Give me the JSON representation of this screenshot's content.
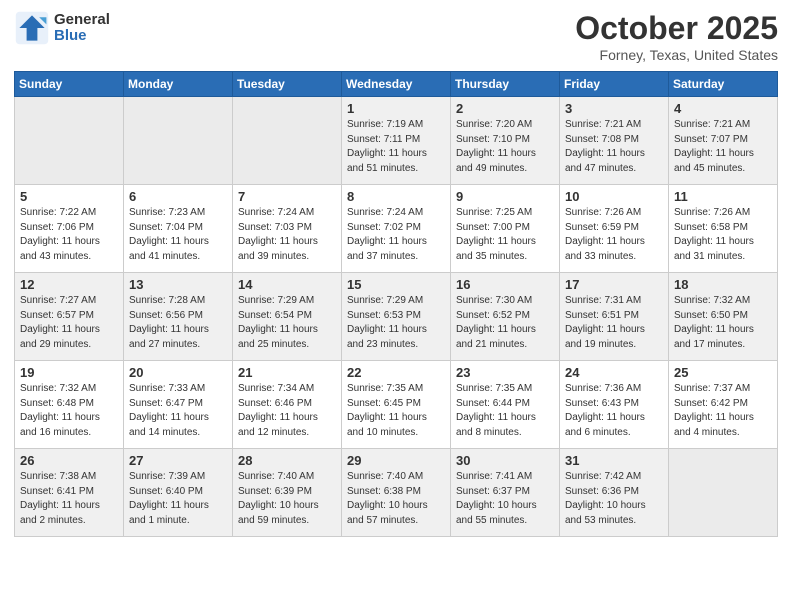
{
  "header": {
    "logo_general": "General",
    "logo_blue": "Blue",
    "title": "October 2025",
    "location": "Forney, Texas, United States"
  },
  "days_of_week": [
    "Sunday",
    "Monday",
    "Tuesday",
    "Wednesday",
    "Thursday",
    "Friday",
    "Saturday"
  ],
  "weeks": [
    [
      {
        "day": "",
        "empty": true
      },
      {
        "day": "",
        "empty": true
      },
      {
        "day": "",
        "empty": true
      },
      {
        "day": "1",
        "sunrise": "7:19 AM",
        "sunset": "7:11 PM",
        "daylight": "11 hours and 51 minutes."
      },
      {
        "day": "2",
        "sunrise": "7:20 AM",
        "sunset": "7:10 PM",
        "daylight": "11 hours and 49 minutes."
      },
      {
        "day": "3",
        "sunrise": "7:21 AM",
        "sunset": "7:08 PM",
        "daylight": "11 hours and 47 minutes."
      },
      {
        "day": "4",
        "sunrise": "7:21 AM",
        "sunset": "7:07 PM",
        "daylight": "11 hours and 45 minutes."
      }
    ],
    [
      {
        "day": "5",
        "sunrise": "7:22 AM",
        "sunset": "7:06 PM",
        "daylight": "11 hours and 43 minutes."
      },
      {
        "day": "6",
        "sunrise": "7:23 AM",
        "sunset": "7:04 PM",
        "daylight": "11 hours and 41 minutes."
      },
      {
        "day": "7",
        "sunrise": "7:24 AM",
        "sunset": "7:03 PM",
        "daylight": "11 hours and 39 minutes."
      },
      {
        "day": "8",
        "sunrise": "7:24 AM",
        "sunset": "7:02 PM",
        "daylight": "11 hours and 37 minutes."
      },
      {
        "day": "9",
        "sunrise": "7:25 AM",
        "sunset": "7:00 PM",
        "daylight": "11 hours and 35 minutes."
      },
      {
        "day": "10",
        "sunrise": "7:26 AM",
        "sunset": "6:59 PM",
        "daylight": "11 hours and 33 minutes."
      },
      {
        "day": "11",
        "sunrise": "7:26 AM",
        "sunset": "6:58 PM",
        "daylight": "11 hours and 31 minutes."
      }
    ],
    [
      {
        "day": "12",
        "sunrise": "7:27 AM",
        "sunset": "6:57 PM",
        "daylight": "11 hours and 29 minutes."
      },
      {
        "day": "13",
        "sunrise": "7:28 AM",
        "sunset": "6:56 PM",
        "daylight": "11 hours and 27 minutes."
      },
      {
        "day": "14",
        "sunrise": "7:29 AM",
        "sunset": "6:54 PM",
        "daylight": "11 hours and 25 minutes."
      },
      {
        "day": "15",
        "sunrise": "7:29 AM",
        "sunset": "6:53 PM",
        "daylight": "11 hours and 23 minutes."
      },
      {
        "day": "16",
        "sunrise": "7:30 AM",
        "sunset": "6:52 PM",
        "daylight": "11 hours and 21 minutes."
      },
      {
        "day": "17",
        "sunrise": "7:31 AM",
        "sunset": "6:51 PM",
        "daylight": "11 hours and 19 minutes."
      },
      {
        "day": "18",
        "sunrise": "7:32 AM",
        "sunset": "6:50 PM",
        "daylight": "11 hours and 17 minutes."
      }
    ],
    [
      {
        "day": "19",
        "sunrise": "7:32 AM",
        "sunset": "6:48 PM",
        "daylight": "11 hours and 16 minutes."
      },
      {
        "day": "20",
        "sunrise": "7:33 AM",
        "sunset": "6:47 PM",
        "daylight": "11 hours and 14 minutes."
      },
      {
        "day": "21",
        "sunrise": "7:34 AM",
        "sunset": "6:46 PM",
        "daylight": "11 hours and 12 minutes."
      },
      {
        "day": "22",
        "sunrise": "7:35 AM",
        "sunset": "6:45 PM",
        "daylight": "11 hours and 10 minutes."
      },
      {
        "day": "23",
        "sunrise": "7:35 AM",
        "sunset": "6:44 PM",
        "daylight": "11 hours and 8 minutes."
      },
      {
        "day": "24",
        "sunrise": "7:36 AM",
        "sunset": "6:43 PM",
        "daylight": "11 hours and 6 minutes."
      },
      {
        "day": "25",
        "sunrise": "7:37 AM",
        "sunset": "6:42 PM",
        "daylight": "11 hours and 4 minutes."
      }
    ],
    [
      {
        "day": "26",
        "sunrise": "7:38 AM",
        "sunset": "6:41 PM",
        "daylight": "11 hours and 2 minutes."
      },
      {
        "day": "27",
        "sunrise": "7:39 AM",
        "sunset": "6:40 PM",
        "daylight": "11 hours and 1 minute."
      },
      {
        "day": "28",
        "sunrise": "7:40 AM",
        "sunset": "6:39 PM",
        "daylight": "10 hours and 59 minutes."
      },
      {
        "day": "29",
        "sunrise": "7:40 AM",
        "sunset": "6:38 PM",
        "daylight": "10 hours and 57 minutes."
      },
      {
        "day": "30",
        "sunrise": "7:41 AM",
        "sunset": "6:37 PM",
        "daylight": "10 hours and 55 minutes."
      },
      {
        "day": "31",
        "sunrise": "7:42 AM",
        "sunset": "6:36 PM",
        "daylight": "10 hours and 53 minutes."
      },
      {
        "day": "",
        "empty": true
      }
    ]
  ]
}
